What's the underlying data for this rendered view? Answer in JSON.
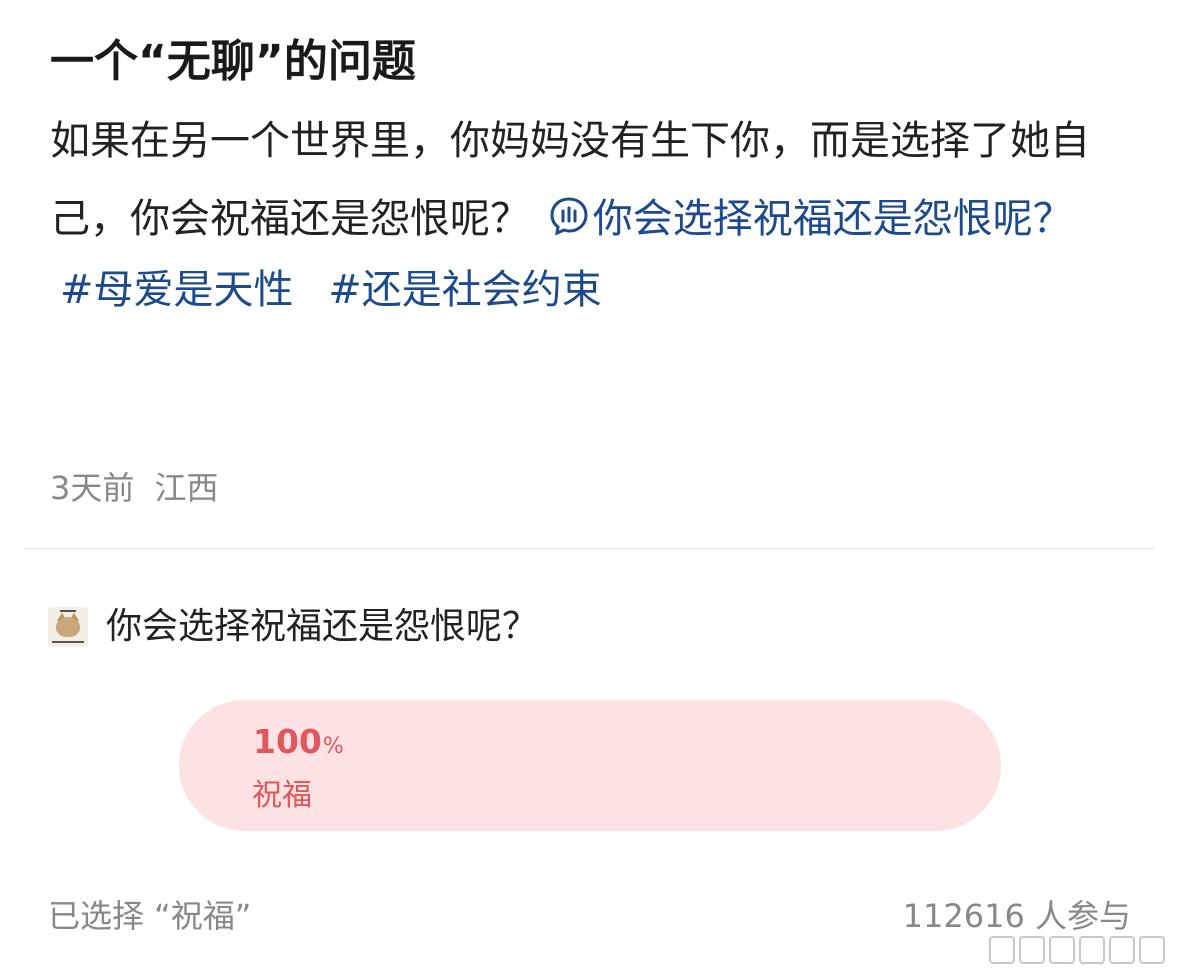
{
  "post": {
    "title": "一个“无聊”的问题",
    "body_line1": "如果在另一个世界里，你妈妈没有生下你，而是选择了她自己，你会祝福还是怨恨呢？",
    "topic_link": "你会选择祝福还是怨恨呢？",
    "hashtags": [
      "#母爱是天性",
      "#还是社会约束"
    ],
    "time": "3天前",
    "location": "江西"
  },
  "poll": {
    "question": "你会选择祝福还是怨恨呢？",
    "options": [
      {
        "percent": "100",
        "percent_unit": "%",
        "label": "祝福",
        "fraction": 1.0
      }
    ],
    "selected_text": "已选择 “祝福”",
    "participants": "112616 人参与"
  },
  "colors": {
    "link": "#1c4a8a",
    "poll_accent": "#e0575d",
    "poll_bg": "#fde7e8"
  },
  "icons": {
    "topic_link_icon": "chat-bubble-icon",
    "poll_avatar": "cat-meme-avatar"
  }
}
